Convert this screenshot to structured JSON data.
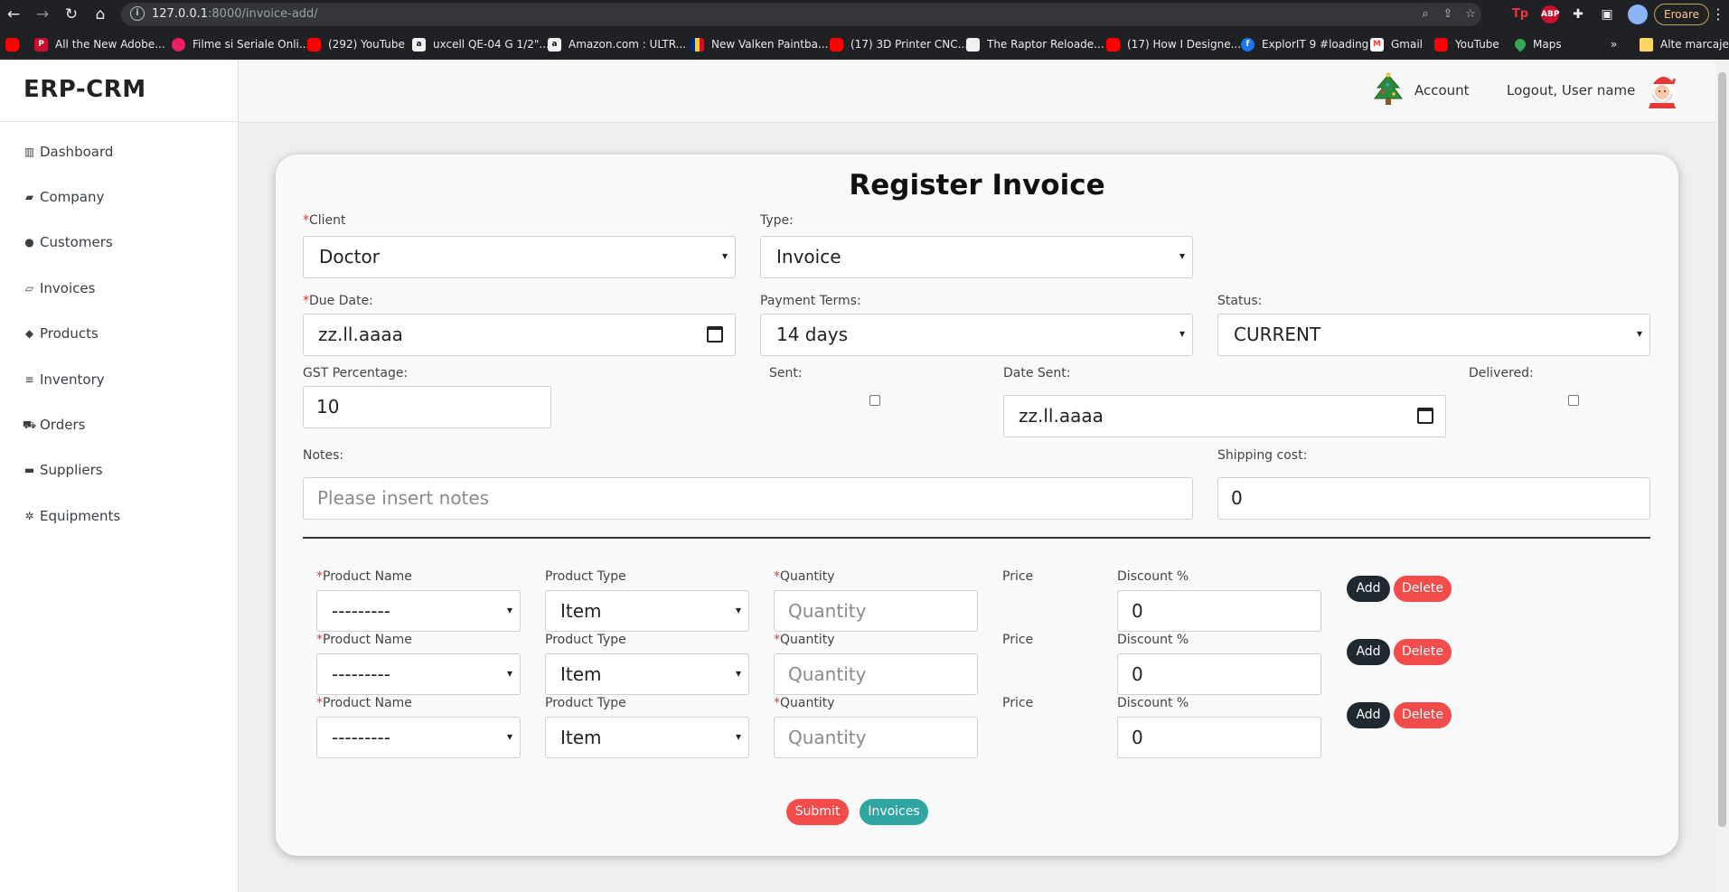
{
  "browser": {
    "url_host": "127.0.0.1",
    "url_path": ":8000/invoice-add/",
    "error_pill": "Eroare",
    "bookmarks": [
      {
        "label": "",
        "fav": "yt",
        "icon_name": "youtube-icon"
      },
      {
        "label": "All the New Adobe...",
        "fav": "red",
        "icon_name": "p-icon"
      },
      {
        "label": "Filme si Seriale Onli...",
        "fav": "pink",
        "icon_name": "play-icon"
      },
      {
        "label": "(292) YouTube",
        "fav": "yt",
        "icon_name": "youtube-icon"
      },
      {
        "label": "uxcell QE-04 G 1/2\"...",
        "fav": "white",
        "icon_name": "amazon-icon"
      },
      {
        "label": "Amazon.com : ULTR...",
        "fav": "white",
        "icon_name": "amazon-icon"
      },
      {
        "label": "New Valken Paintba...",
        "fav": "flag",
        "icon_name": "flag-icon"
      },
      {
        "label": "(17) 3D Printer CNC...",
        "fav": "yt",
        "icon_name": "youtube-icon"
      },
      {
        "label": "The Raptor Reloade...",
        "fav": "white",
        "icon_name": "site-icon"
      },
      {
        "label": "(17) How I Designe...",
        "fav": "yt",
        "icon_name": "youtube-icon"
      },
      {
        "label": "ExplorIT 9 #loading",
        "fav": "fb",
        "icon_name": "facebook-icon"
      },
      {
        "label": "Gmail",
        "fav": "gm",
        "icon_name": "gmail-icon"
      },
      {
        "label": "YouTube",
        "fav": "yt",
        "icon_name": "youtube-icon"
      },
      {
        "label": "Maps",
        "fav": "maps",
        "icon_name": "maps-icon"
      },
      {
        "label": "»",
        "fav": "",
        "icon_name": ""
      },
      {
        "label": "Alte marcaje",
        "fav": "folder",
        "icon_name": "folder-icon"
      }
    ]
  },
  "app": {
    "brand": "ERP-CRM",
    "topbar": {
      "account": "Account",
      "logout": "Logout, User name"
    },
    "sidebar": {
      "items": [
        {
          "label": "Dashboard",
          "icon": "bar-chart-icon"
        },
        {
          "label": "Company",
          "icon": "folder-icon"
        },
        {
          "label": "Customers",
          "icon": "user-circle-icon"
        },
        {
          "label": "Invoices",
          "icon": "folder-open-icon"
        },
        {
          "label": "Products",
          "icon": "tags-icon"
        },
        {
          "label": "Inventory",
          "icon": "list-icon"
        },
        {
          "label": "Orders",
          "icon": "cart-icon"
        },
        {
          "label": "Suppliers",
          "icon": "truck-icon"
        },
        {
          "label": "Equipments",
          "icon": "cogs-icon"
        }
      ]
    }
  },
  "form": {
    "title": "Register Invoice",
    "required_mark": "*",
    "client": {
      "label": "Client",
      "value": "Doctor"
    },
    "type": {
      "label": "Type:",
      "value": "Invoice"
    },
    "due_date": {
      "label": "Due Date:",
      "value": "zz.ll.aaaa"
    },
    "payment_terms": {
      "label": "Payment Terms:",
      "value": "14 days"
    },
    "status": {
      "label": "Status:",
      "value": "CURRENT"
    },
    "gst": {
      "label": "GST Percentage:",
      "value": "10"
    },
    "sent": {
      "label": "Sent:",
      "checked": false
    },
    "date_sent": {
      "label": "Date Sent:",
      "value": "zz.ll.aaaa"
    },
    "delivered": {
      "label": "Delivered:",
      "checked": false
    },
    "notes": {
      "label": "Notes:",
      "placeholder": "Please insert notes"
    },
    "shipping": {
      "label": "Shipping cost:",
      "value": "0"
    },
    "line_items": {
      "labels": {
        "product_name": "Product Name",
        "product_type": "Product Type",
        "quantity": "Quantity",
        "price": "Price",
        "discount": "Discount %"
      },
      "rows": [
        {
          "product": "---------",
          "type": "Item",
          "quantity_placeholder": "Quantity",
          "discount": "0"
        },
        {
          "product": "---------",
          "type": "Item",
          "quantity_placeholder": "Quantity",
          "discount": "0"
        },
        {
          "product": "---------",
          "type": "Item",
          "quantity_placeholder": "Quantity",
          "discount": "0"
        }
      ],
      "add_label": "Add",
      "delete_label": "Delete"
    },
    "submit_label": "Submit",
    "invoices_label": "Invoices"
  },
  "colors": {
    "required": "#e53935",
    "add_button": "#1f2a30",
    "delete_button": "#f44b4b",
    "submit_button": "#f44b4b",
    "invoices_button": "#30a6a2"
  }
}
